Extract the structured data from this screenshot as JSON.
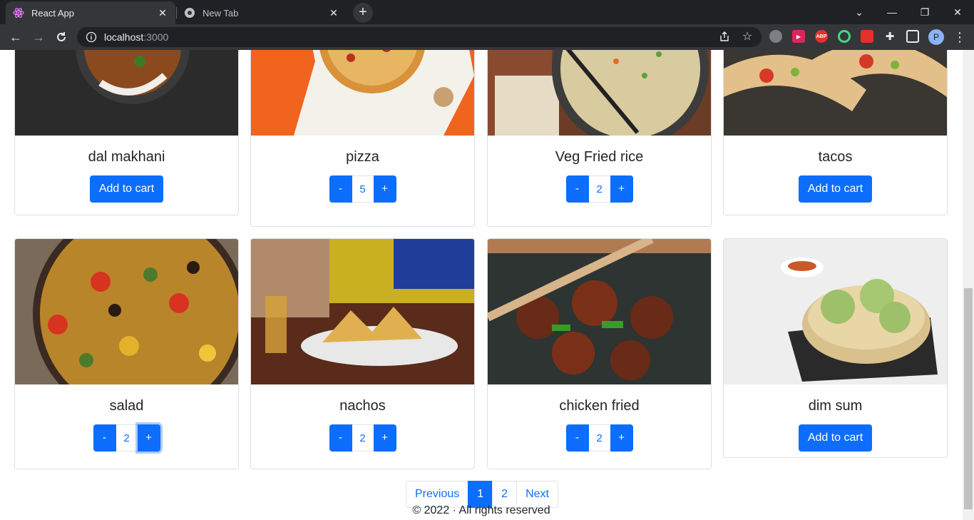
{
  "browser": {
    "tabs": [
      {
        "title": "React App",
        "active": true
      },
      {
        "title": "New Tab",
        "active": false
      }
    ],
    "url_host": "localhost",
    "url_port": ":3000",
    "profile_initial": "P",
    "extensions": [
      "ABP"
    ]
  },
  "products": [
    {
      "name": "dal makhani",
      "in_cart": false,
      "quantity": null,
      "action_label": "Add to cart"
    },
    {
      "name": "pizza",
      "in_cart": true,
      "quantity": "5"
    },
    {
      "name": "Veg Fried rice",
      "in_cart": true,
      "quantity": "2"
    },
    {
      "name": "tacos",
      "in_cart": false,
      "quantity": null,
      "action_label": "Add to cart"
    },
    {
      "name": "salad",
      "in_cart": true,
      "quantity": "2"
    },
    {
      "name": "nachos",
      "in_cart": true,
      "quantity": "2"
    },
    {
      "name": "chicken fried",
      "in_cart": true,
      "quantity": "2"
    },
    {
      "name": "dim sum",
      "in_cart": false,
      "quantity": null,
      "action_label": "Add to cart"
    }
  ],
  "qty_controls": {
    "minus": "-",
    "plus": "+"
  },
  "pagination": {
    "previous": "Previous",
    "pages": [
      "1",
      "2"
    ],
    "active_page": "1",
    "next": "Next"
  },
  "footer": "© 2022 · All rights reserved",
  "colors": {
    "primary": "#0d6efd",
    "chrome_dark": "#202124",
    "chrome_mid": "#35363a"
  }
}
